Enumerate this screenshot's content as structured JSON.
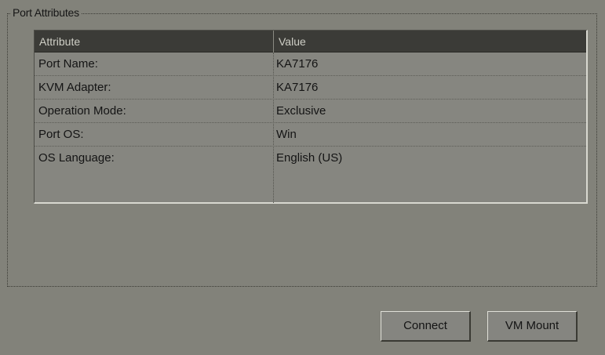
{
  "panel": {
    "group_title": "Port Attributes",
    "columns": {
      "attribute": "Attribute",
      "value": "Value"
    },
    "rows": [
      {
        "attribute": "Port Name:",
        "value": "KA7176"
      },
      {
        "attribute": "KVM Adapter:",
        "value": "KA7176"
      },
      {
        "attribute": "Operation Mode:",
        "value": "Exclusive"
      },
      {
        "attribute": "Port OS:",
        "value": "Win"
      },
      {
        "attribute": "OS Language:",
        "value": "English (US)"
      }
    ]
  },
  "actions": {
    "connect_label": "Connect",
    "vm_mount_label": "VM Mount"
  },
  "colors": {
    "window_background": "#82827a",
    "header_background": "#3b3b37",
    "header_text": "#cfcfc6"
  }
}
